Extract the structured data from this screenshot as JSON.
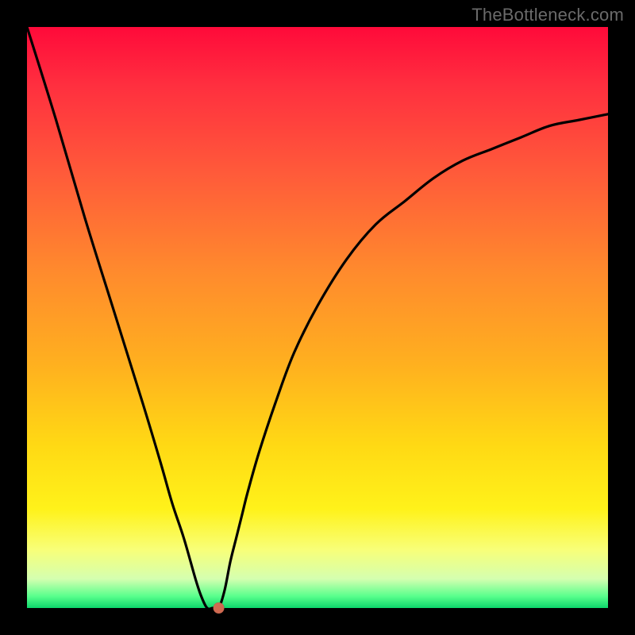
{
  "watermark": "TheBottleneck.com",
  "chart_data": {
    "type": "line",
    "title": "",
    "xlabel": "",
    "ylabel": "",
    "xlim": [
      0,
      100
    ],
    "ylim": [
      0,
      100
    ],
    "grid": false,
    "x": [
      0,
      5,
      10,
      15,
      20,
      23,
      25,
      27,
      29,
      30,
      31,
      32,
      33,
      34,
      35,
      36,
      37,
      38,
      40,
      43,
      46,
      50,
      55,
      60,
      65,
      70,
      75,
      80,
      85,
      90,
      95,
      100
    ],
    "values": [
      100,
      84,
      67,
      51,
      35,
      25,
      18,
      12,
      5,
      2,
      0,
      0,
      0,
      3,
      8,
      12,
      16,
      20,
      27,
      36,
      44,
      52,
      60,
      66,
      70,
      74,
      77,
      79,
      81,
      83,
      84,
      85
    ],
    "marker": {
      "x": 33,
      "y": 0,
      "color": "#d06a51"
    },
    "colors": {
      "line": "#000000",
      "background_top": "#ff0a3a",
      "background_bottom": "#0dd66b"
    }
  }
}
